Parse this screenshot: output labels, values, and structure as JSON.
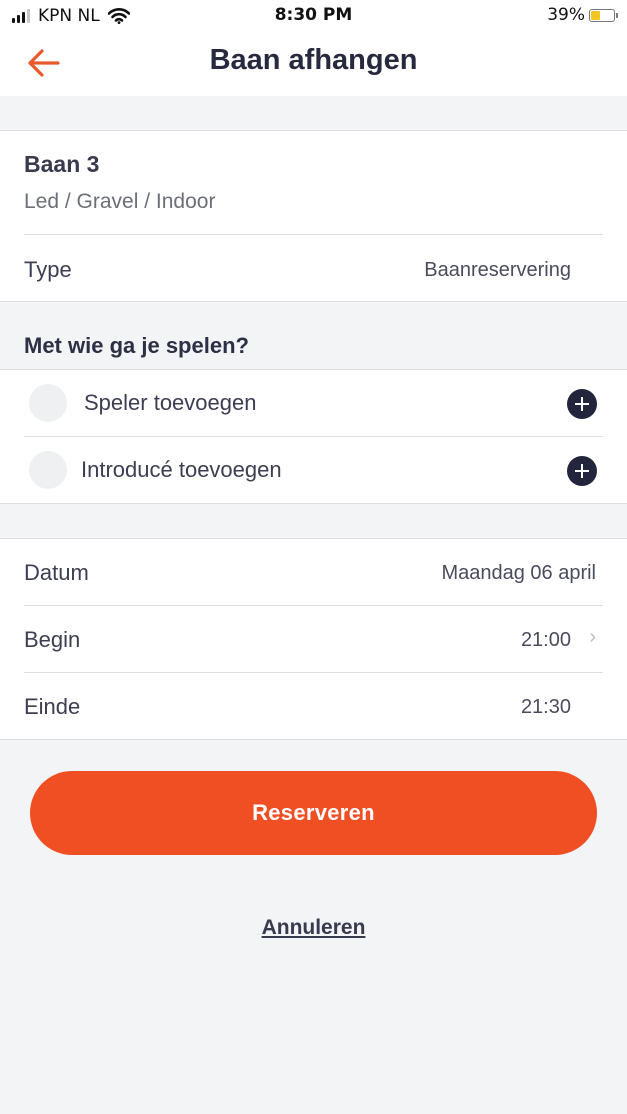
{
  "status_bar": {
    "carrier": "KPN NL",
    "time": "8:30 PM",
    "battery_percent": "39%"
  },
  "nav": {
    "title": "Baan afhangen",
    "back_icon": "arrow-left-icon",
    "accent_color": "#f04e23"
  },
  "court": {
    "name": "Baan 3",
    "details": "Led / Gravel / Indoor",
    "type_label": "Type",
    "type_value": "Baanreservering"
  },
  "players": {
    "title": "Met wie ga je spelen?",
    "items": [
      {
        "label": "Speler toevoegen",
        "icon": "plus-circle-icon"
      },
      {
        "label": "Introducé toevoegen",
        "icon": "plus-circle-icon"
      }
    ]
  },
  "schedule": {
    "rows": [
      {
        "label": "Datum",
        "value": "Maandag 06 april"
      },
      {
        "label": "Begin",
        "value": "21:00"
      },
      {
        "label": "Einde",
        "value": "21:30"
      }
    ]
  },
  "actions": {
    "reserve_label": "Reserveren",
    "cancel_label": "Annuleren"
  }
}
